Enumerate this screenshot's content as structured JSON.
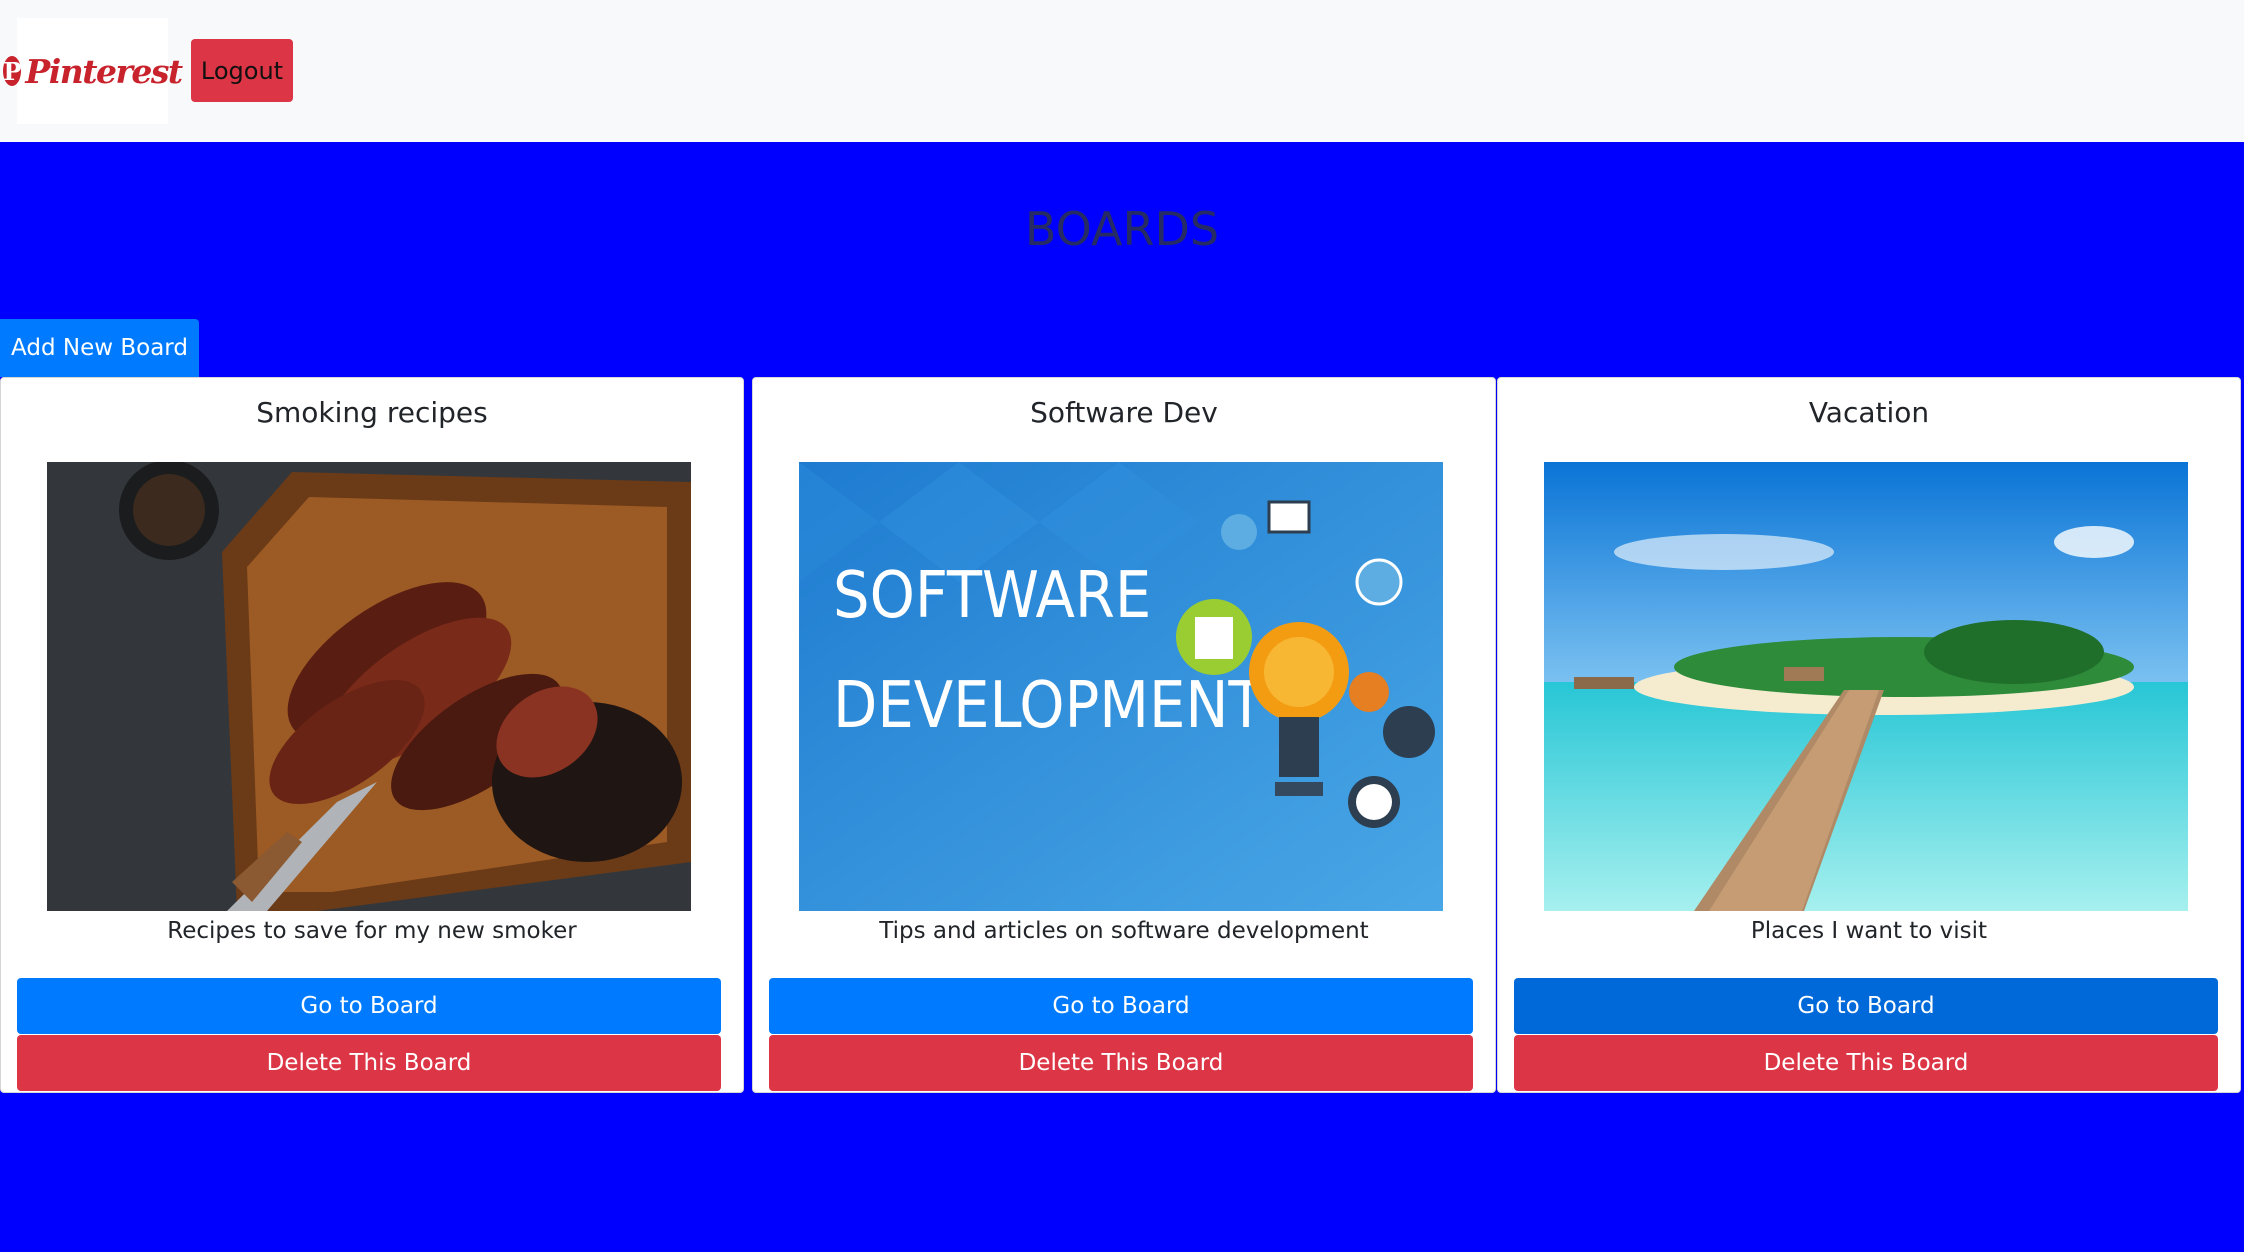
{
  "navbar": {
    "logo_text": "Pinterest",
    "logout_label": "Logout"
  },
  "hero": {
    "title": "BOARDS",
    "add_board_label": "Add New Board"
  },
  "boards": [
    {
      "title": "Smoking recipes",
      "description": "Recipes to save for my new smoker",
      "image": "smoked-brisket-image",
      "go_label": "Go to Board",
      "delete_label": "Delete This Board"
    },
    {
      "title": "Software Dev",
      "description": "Tips and articles on software development",
      "image": "software-development-image",
      "image_text_line1": "SOFTWARE",
      "image_text_line2": "DEVELOPMENT",
      "go_label": "Go to Board",
      "delete_label": "Delete This Board"
    },
    {
      "title": "Vacation",
      "description": "Places I want to visit",
      "image": "tropical-beach-image",
      "go_label": "Go to Board",
      "delete_label": "Delete This Board"
    }
  ],
  "colors": {
    "page_background": "#0000ff",
    "navbar_background": "#f8f9fa",
    "primary": "#007bff",
    "primary_hover": "#0069d9",
    "danger": "#dc3545",
    "brand": "#c8232c"
  }
}
